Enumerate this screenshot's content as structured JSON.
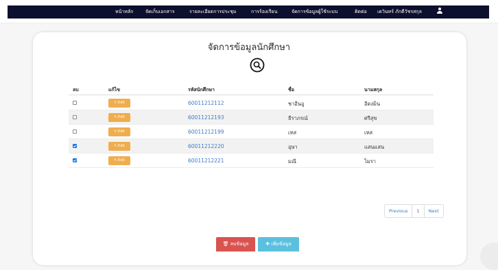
{
  "nav": {
    "items": [
      "หน้าหลัก",
      "จัดเก็บเอกสาร",
      "รายละเอียดการประชุม",
      "การร้องเรียน",
      "จัดการข้อมูลผู้ใช้ระบบ",
      "ติดต่อ",
      "เดวินทร์ ภักดีวัชรสกุล"
    ],
    "user_icon": "user-icon",
    "bar_color": "#0d0f2e"
  },
  "page": {
    "title": "จัดการข้อมูลนักศึกษา",
    "search_icon": "search-icon"
  },
  "table": {
    "headers": [
      "ลบ",
      "แก้ไข",
      "รหัสนักศึกษา",
      "ชื่อ",
      "นามสกุล"
    ],
    "edit_label": "Edit",
    "rows": [
      {
        "checked": false,
        "id": "60011212112",
        "first": "ชาอีนอู",
        "last": "อีดงมิน"
      },
      {
        "checked": false,
        "id": "60011212193",
        "first": "ธีราภรณ์",
        "last": "ศรีสุข"
      },
      {
        "checked": false,
        "id": "60011212199",
        "first": "เทส",
        "last": "เทส"
      },
      {
        "checked": true,
        "id": "60011212220",
        "first": "อุษา",
        "last": "แสนแสน"
      },
      {
        "checked": true,
        "id": "60011212221",
        "first": "มณี",
        "last": "ไมรา"
      }
    ]
  },
  "pagination": {
    "previous": "Previous",
    "page": "1",
    "next": "Next"
  },
  "actions": {
    "delete_label": "ลบข้อมูล",
    "add_label": "เพิ่มข้อมูล"
  },
  "colors": {
    "edit": "#f0ad4e",
    "delete": "#d9534f",
    "add": "#5bc0de",
    "link": "#3a7ac9"
  }
}
